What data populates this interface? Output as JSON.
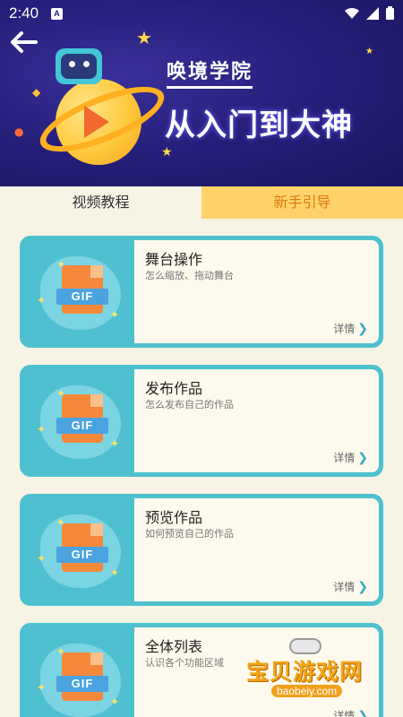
{
  "status_bar": {
    "time": "2:40",
    "badge": "A"
  },
  "banner": {
    "academy": "唤境学院",
    "slogan": "从入门到大神"
  },
  "tabs": [
    {
      "label": "视频教程",
      "active": true
    },
    {
      "label": "新手引导",
      "active": false
    }
  ],
  "cards": [
    {
      "title": "舞台操作",
      "desc": "怎么缩放、拖动舞台",
      "badge": "GIF",
      "detail": "详情"
    },
    {
      "title": "发布作品",
      "desc": "怎么发布自己的作品",
      "badge": "GIF",
      "detail": "详情"
    },
    {
      "title": "预览作品",
      "desc": "如何预览自己的作品",
      "badge": "GIF",
      "detail": "详情"
    },
    {
      "title": "全体列表",
      "desc": "认识各个功能区域",
      "badge": "GIF",
      "detail": "详情"
    }
  ],
  "watermark": {
    "name": "宝贝游戏网",
    "url": "baobeiy.com"
  },
  "colors": {
    "header": "#27207c",
    "card": "#4fc0cf",
    "tab_inactive": "#ffd36a",
    "tab_inactive_text": "#e07a10",
    "background": "#f7f4e5"
  }
}
